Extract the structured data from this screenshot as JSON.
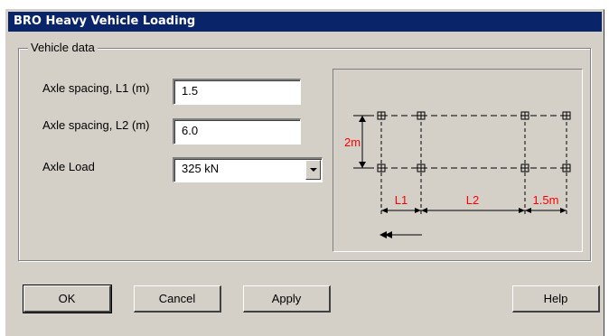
{
  "window": {
    "title": "BRO Heavy Vehicle Loading"
  },
  "group": {
    "legend": "Vehicle data"
  },
  "fields": {
    "l1_label": "Axle spacing, L1 (m)",
    "l1_value": "1.5",
    "l2_label": "Axle spacing, L2 (m)",
    "l2_value": "6.0",
    "load_label": "Axle Load",
    "load_value": "325 kN"
  },
  "diagram": {
    "height_label": "2m",
    "l1_label": "L1",
    "l2_label": "L2",
    "end_label": "1.5m",
    "accent_color": "#ff0000"
  },
  "buttons": {
    "ok": "OK",
    "cancel": "Cancel",
    "apply": "Apply",
    "help": "Help"
  }
}
